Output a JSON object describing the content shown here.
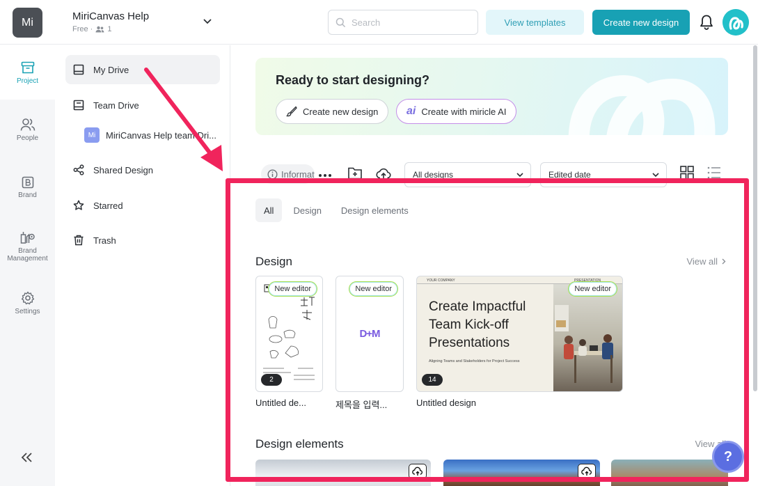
{
  "header": {
    "logo_text": "Mi",
    "workspace_name": "MiriCanvas Help",
    "workspace_plan": "Free ·",
    "member_count": "1",
    "search_placeholder": "Search",
    "view_templates_label": "View templates",
    "create_new_design_label": "Create new design"
  },
  "rail": {
    "items": [
      {
        "label": "Project",
        "icon": "archive-box-icon",
        "active": true
      },
      {
        "label": "People",
        "icon": "people-icon"
      },
      {
        "label": "Brand",
        "icon": "brand-b-icon"
      },
      {
        "label": "Brand Management",
        "icon": "brand-management-icon"
      },
      {
        "label": "Settings",
        "icon": "gear-icon"
      }
    ],
    "collapse_icon": "double-chevron-left-icon"
  },
  "sidenav": {
    "items": [
      {
        "label": "My Drive",
        "icon": "drive-icon",
        "active": true
      },
      {
        "label": "Team Drive",
        "icon": "team-drive-icon"
      },
      {
        "label": "MiriCanvas Help team Dri...",
        "icon": "team-badge",
        "badge": "Mi"
      },
      {
        "label": "Shared Design",
        "icon": "share-icon"
      },
      {
        "label": "Starred",
        "icon": "star-icon"
      },
      {
        "label": "Trash",
        "icon": "trash-icon"
      }
    ]
  },
  "hero": {
    "title": "Ready to start designing?",
    "create_label": "Create new design",
    "ai_label": "Create with miricle AI"
  },
  "toolbar": {
    "info_label": "Informat",
    "filter_label": "All designs",
    "sort_label": "Edited date"
  },
  "tabs": [
    "All",
    "Design",
    "Design elements"
  ],
  "design_section": {
    "title": "Design",
    "view_all": "View all",
    "cards": [
      {
        "title": "Untitled de...",
        "badge": "New editor",
        "pages": "2"
      },
      {
        "title": "제목을 입력...",
        "badge": "New editor",
        "logo": "D+M"
      },
      {
        "title": "Untitled design",
        "badge": "New editor",
        "pages": "14",
        "slide_company": "YOUR COMPANY",
        "slide_tag": "PRESENTATION",
        "slide_heading": "Create Impactful Team Kick-off Presentations",
        "slide_sub": "Aligning Teams and Stakeholders for Project Success"
      }
    ]
  },
  "elements_section": {
    "title": "Design elements",
    "view_all": "View all"
  },
  "help_fab": "?",
  "colors": {
    "brand": "#18a1b4",
    "brand_light": "#e3f6fa",
    "annotation": "#f0245c"
  }
}
